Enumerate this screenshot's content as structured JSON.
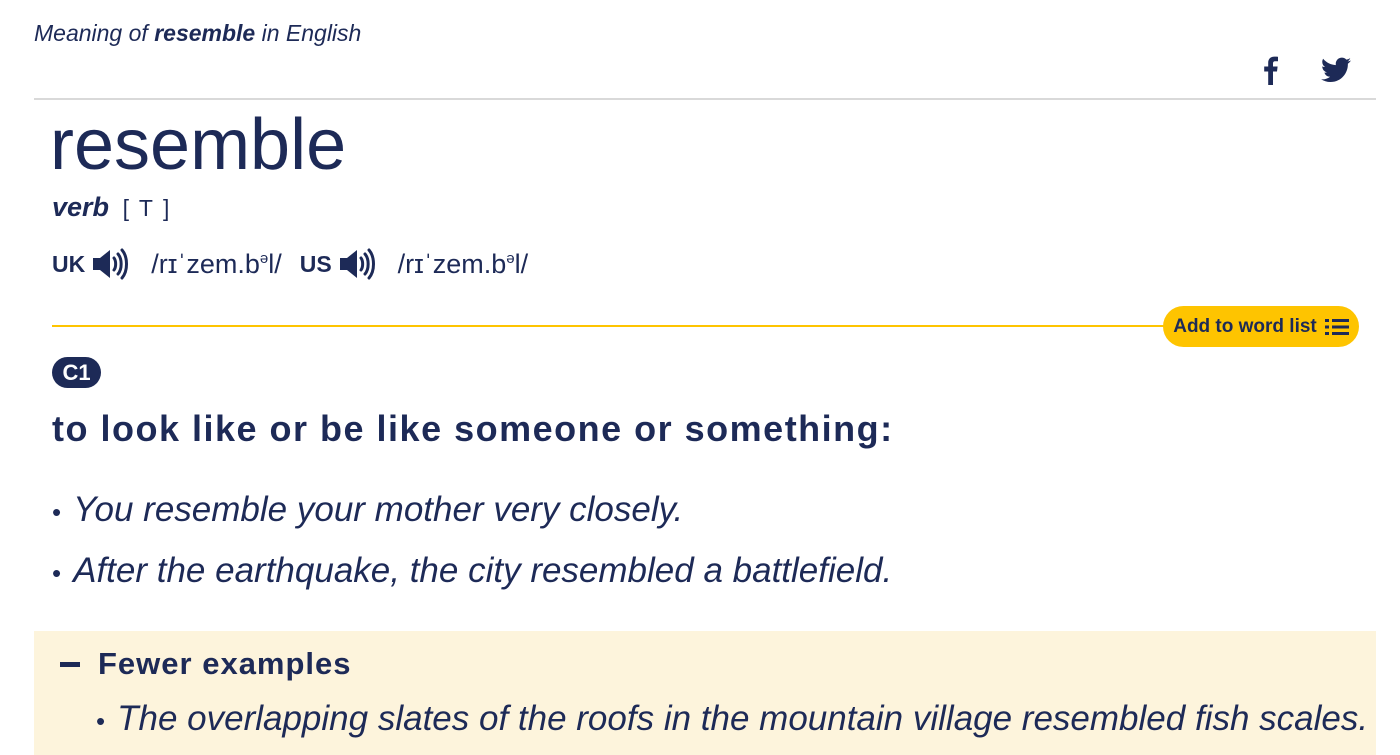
{
  "header": {
    "meaning_prefix": "Meaning of",
    "word": "resemble",
    "meaning_suffix": "in English"
  },
  "share": {
    "icons": [
      "facebook-icon",
      "twitter-icon"
    ]
  },
  "entry": {
    "headword": "resemble",
    "pos": "verb",
    "grammar": "[ T ]",
    "pronunciations": [
      {
        "region": "UK",
        "ipa_before": "/rɪˈzem.b",
        "ipa_sup": "ə",
        "ipa_after": "l/"
      },
      {
        "region": "US",
        "ipa_before": "/rɪˈzem.b",
        "ipa_sup": "ə",
        "ipa_after": "l/"
      }
    ],
    "add_to_word_list": "Add to word list",
    "level": "C1",
    "definition": "to look like or be like someone or something:",
    "examples": [
      "You resemble your mother very closely.",
      "After the earthquake, the city resembled a battlefield."
    ]
  },
  "more_examples": {
    "toggle_label": "Fewer examples",
    "items": [
      "The overlapping slates of the roofs in the mountain village resembled fish scales."
    ]
  },
  "colors": {
    "text": "#1d2a57",
    "accent": "#fec400",
    "panel": "#fdf4dc"
  }
}
